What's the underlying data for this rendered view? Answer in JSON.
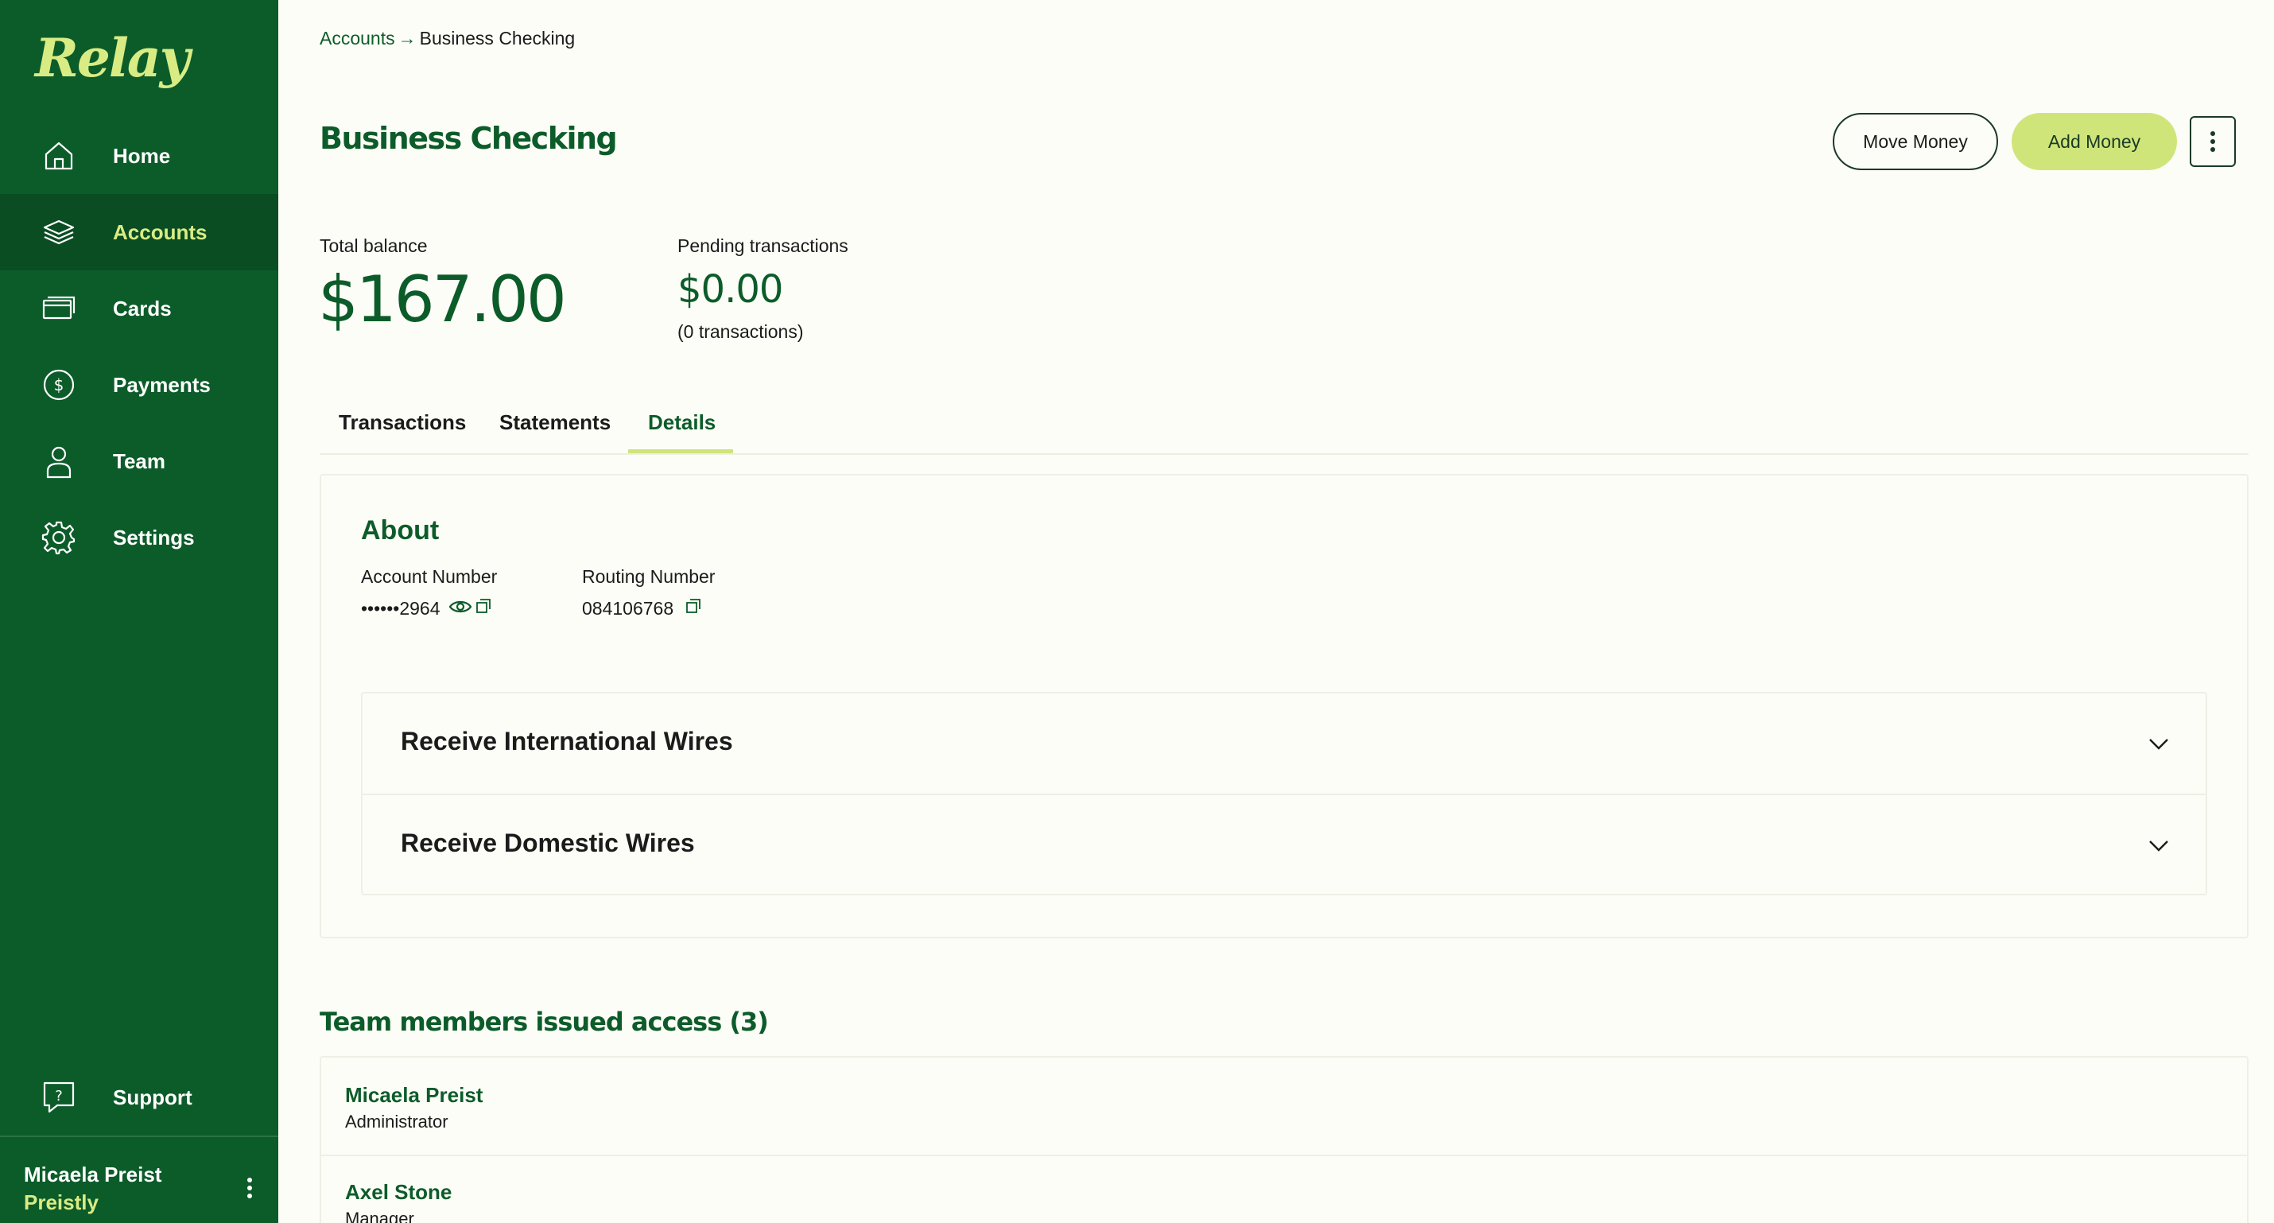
{
  "app": {
    "logo": "Relay"
  },
  "sidebar": {
    "items": [
      {
        "label": "Home",
        "icon": "home-icon"
      },
      {
        "label": "Accounts",
        "icon": "layers-icon",
        "active": true
      },
      {
        "label": "Cards",
        "icon": "card-icon"
      },
      {
        "label": "Payments",
        "icon": "dollar-circle-icon"
      },
      {
        "label": "Team",
        "icon": "user-icon"
      },
      {
        "label": "Settings",
        "icon": "gear-icon"
      }
    ],
    "support": {
      "label": "Support",
      "icon": "help-chat-icon"
    },
    "user": {
      "name": "Micaela Preist",
      "company": "Preistly"
    }
  },
  "breadcrumb": {
    "parent": "Accounts",
    "separator": "→",
    "current": "Business Checking"
  },
  "header": {
    "title": "Business Checking",
    "move_money": "Move Money",
    "add_money": "Add Money"
  },
  "balances": {
    "total_label": "Total balance",
    "total_value": "$167.00",
    "pending_label": "Pending transactions",
    "pending_value": "$0.00",
    "pending_count": "(0 transactions)"
  },
  "tabs": [
    {
      "label": "Transactions"
    },
    {
      "label": "Statements"
    },
    {
      "label": "Details",
      "active": true
    }
  ],
  "about": {
    "title": "About",
    "account_number_label": "Account Number",
    "account_number_value": "••••••2964",
    "routing_number_label": "Routing Number",
    "routing_number_value": "084106768"
  },
  "wires": [
    {
      "label": "Receive International Wires"
    },
    {
      "label": "Receive Domestic Wires"
    }
  ],
  "team": {
    "title": "Team members issued access (3)",
    "members": [
      {
        "name": "Micaela Preist",
        "role": "Administrator"
      },
      {
        "name": "Axel Stone",
        "role": "Manager"
      }
    ]
  },
  "colors": {
    "brand": "#0c5c2a",
    "accent": "#cfe57a",
    "background": "#fdfdf7"
  }
}
